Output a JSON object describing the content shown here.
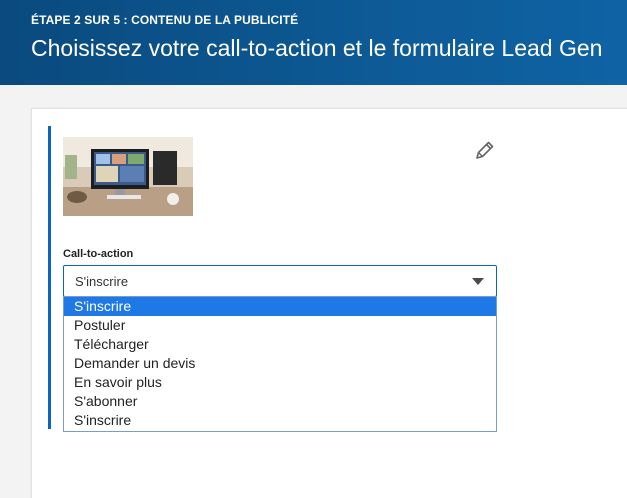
{
  "header": {
    "step": "ÉTAPE 2 SUR 5 : CONTENU DE LA PUBLICITÉ",
    "title": "Choisissez votre call-to-action et le formulaire Lead Gen"
  },
  "ad": {
    "image_icon": "ad-image-thumbnail",
    "edit_icon": "pencil-icon"
  },
  "cta": {
    "label": "Call-to-action",
    "selected_value": "S'inscrire",
    "options": [
      "S'inscrire",
      "Postuler",
      "Télécharger",
      "Demander un devis",
      "En savoir plus",
      "S'abonner",
      "S'inscrire"
    ],
    "selected_index": 0
  },
  "colors": {
    "header_bg": "#0d5a96",
    "accent": "#0a66c2",
    "selected_option_bg": "#1e78e6"
  }
}
